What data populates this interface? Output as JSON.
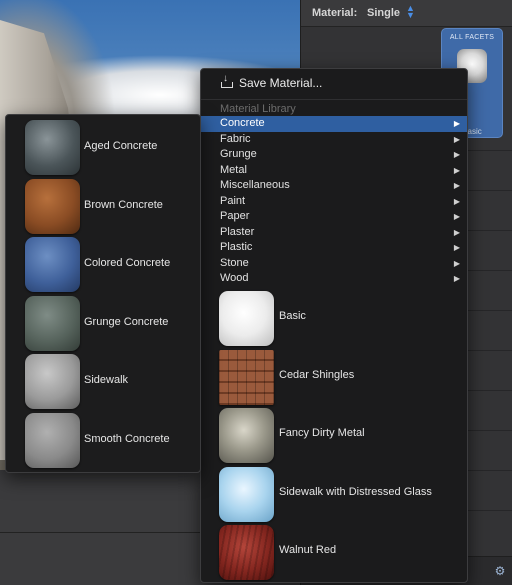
{
  "inspector": {
    "material_label": "Material:",
    "material_value": "Single",
    "facets_label": "ALL FACETS",
    "facets_caption": "Basic"
  },
  "menu": {
    "save_label": "Save Material...",
    "library_header": "Material Library",
    "categories": [
      {
        "label": "Concrete",
        "selected": true
      },
      {
        "label": "Fabric"
      },
      {
        "label": "Grunge"
      },
      {
        "label": "Metal"
      },
      {
        "label": "Miscellaneous"
      },
      {
        "label": "Paint"
      },
      {
        "label": "Paper"
      },
      {
        "label": "Plaster"
      },
      {
        "label": "Plastic"
      },
      {
        "label": "Stone"
      },
      {
        "label": "Wood"
      }
    ],
    "materials": [
      {
        "label": "Basic",
        "thumb": "basic"
      },
      {
        "label": "Cedar Shingles",
        "thumb": "cedar"
      },
      {
        "label": "Fancy Dirty Metal",
        "thumb": "metal"
      },
      {
        "label": "Sidewalk with Distressed Glass",
        "thumb": "glass"
      },
      {
        "label": "Walnut Red",
        "thumb": "walnut"
      }
    ]
  },
  "concrete_submenu": {
    "items": [
      {
        "label": "Aged Concrete",
        "thumb": "aged"
      },
      {
        "label": "Brown Concrete",
        "thumb": "brown"
      },
      {
        "label": "Colored Concrete",
        "thumb": "colored"
      },
      {
        "label": "Grunge Concrete",
        "thumb": "grunge"
      },
      {
        "label": "Sidewalk",
        "thumb": "sidewalk"
      },
      {
        "label": "Smooth Concrete",
        "thumb": "smooth"
      }
    ]
  },
  "colors": {
    "selection": "#2f5fa1",
    "menu_bg": "#1b1b1c",
    "facets_bg": "#3f6aa8"
  }
}
